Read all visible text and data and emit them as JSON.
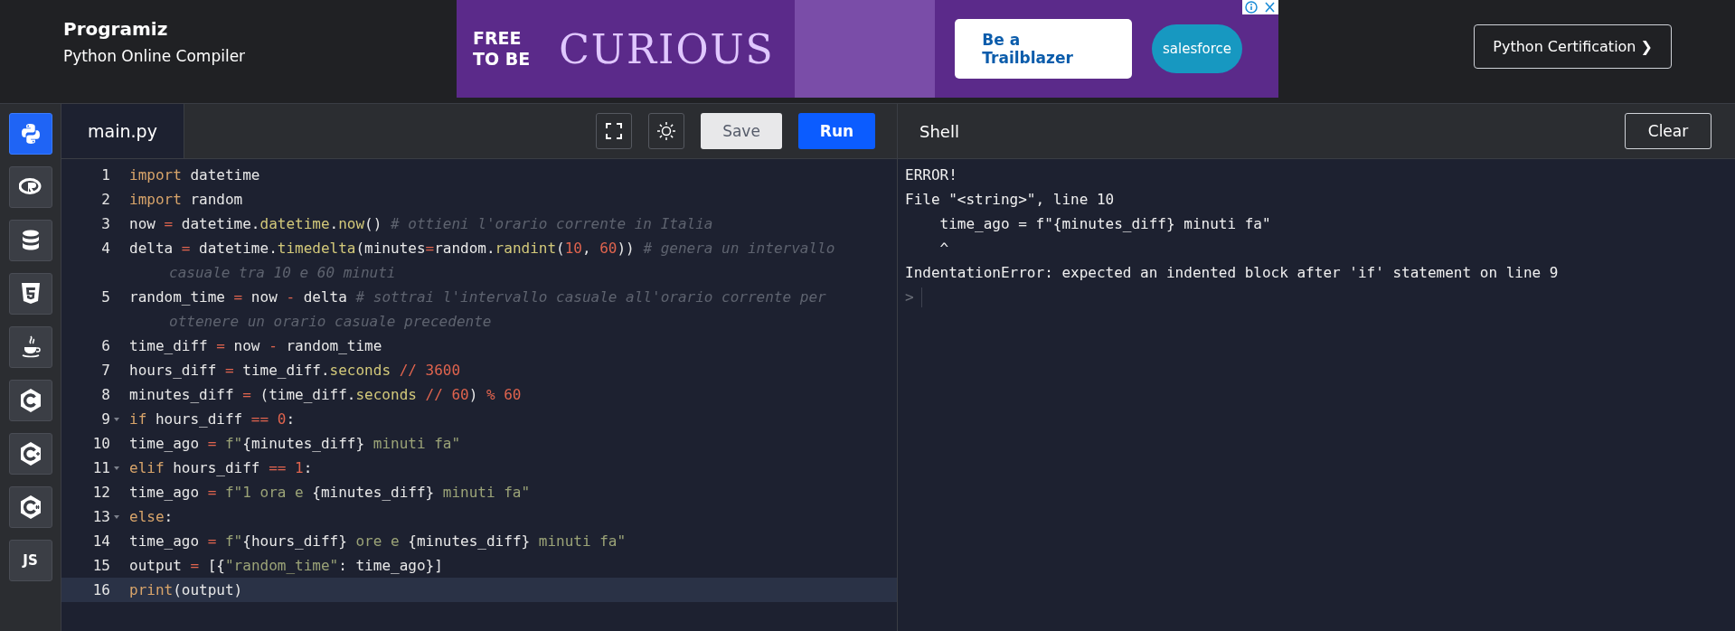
{
  "header": {
    "brand": "Programiz",
    "subtitle": "Python Online Compiler",
    "ad": {
      "headline": "FREE TO BE",
      "wordmark": "CURIOUS",
      "cta": "Be a Trailblazer",
      "sponsor": "salesforce"
    },
    "certification_button": "Python Certification ❯"
  },
  "sidebar": {
    "items": [
      {
        "kind": "python",
        "selected": true
      },
      {
        "kind": "r",
        "selected": false
      },
      {
        "kind": "sql",
        "selected": false
      },
      {
        "kind": "html",
        "selected": false
      },
      {
        "kind": "java",
        "selected": false
      },
      {
        "kind": "c",
        "selected": false
      },
      {
        "kind": "cpp",
        "selected": false
      },
      {
        "kind": "csharp",
        "selected": false
      },
      {
        "kind": "js",
        "label": "JS",
        "selected": false
      }
    ]
  },
  "editor": {
    "tab": "main.py",
    "save_button": "Save",
    "run_button": "Run",
    "lines": [
      {
        "number": "1",
        "fold": false,
        "current": false,
        "tokens": [
          {
            "kind": "kw",
            "text": "import"
          },
          {
            "kind": "p",
            "text": " datetime"
          }
        ]
      },
      {
        "number": "2",
        "fold": false,
        "current": false,
        "tokens": [
          {
            "kind": "kw",
            "text": "import"
          },
          {
            "kind": "p",
            "text": " random"
          }
        ]
      },
      {
        "number": "3",
        "fold": false,
        "current": false,
        "tokens": [
          {
            "kind": "p",
            "text": "now "
          },
          {
            "kind": "op",
            "text": "="
          },
          {
            "kind": "p",
            "text": " datetime."
          },
          {
            "kind": "fn",
            "text": "datetime"
          },
          {
            "kind": "p",
            "text": "."
          },
          {
            "kind": "fn",
            "text": "now"
          },
          {
            "kind": "p",
            "text": "() "
          },
          {
            "kind": "cm",
            "text": "# ottieni l'orario corrente in Italia"
          }
        ]
      },
      {
        "number": "4",
        "fold": false,
        "current": false,
        "tokens": [
          {
            "kind": "p",
            "text": "delta "
          },
          {
            "kind": "op",
            "text": "="
          },
          {
            "kind": "p",
            "text": " datetime."
          },
          {
            "kind": "fn",
            "text": "timedelta"
          },
          {
            "kind": "p",
            "text": "(minutes"
          },
          {
            "kind": "op",
            "text": "="
          },
          {
            "kind": "p",
            "text": "random."
          },
          {
            "kind": "fn",
            "text": "randint"
          },
          {
            "kind": "p",
            "text": "("
          },
          {
            "kind": "num",
            "text": "10"
          },
          {
            "kind": "p",
            "text": ", "
          },
          {
            "kind": "num",
            "text": "60"
          },
          {
            "kind": "p",
            "text": ")) "
          },
          {
            "kind": "cm",
            "text": "# genera un intervallo casuale tra 10 e 60 minuti"
          }
        ]
      },
      {
        "number": "5",
        "fold": false,
        "current": false,
        "tokens": [
          {
            "kind": "p",
            "text": "random_time "
          },
          {
            "kind": "op",
            "text": "="
          },
          {
            "kind": "p",
            "text": " now "
          },
          {
            "kind": "op",
            "text": "-"
          },
          {
            "kind": "p",
            "text": " delta "
          },
          {
            "kind": "cm",
            "text": "# sottrai l'intervallo casuale all'orario corrente per ottenere un orario casuale precedente"
          }
        ]
      },
      {
        "number": "6",
        "fold": false,
        "current": false,
        "tokens": [
          {
            "kind": "p",
            "text": "time_diff "
          },
          {
            "kind": "op",
            "text": "="
          },
          {
            "kind": "p",
            "text": " now "
          },
          {
            "kind": "op",
            "text": "-"
          },
          {
            "kind": "p",
            "text": " random_time"
          }
        ]
      },
      {
        "number": "7",
        "fold": false,
        "current": false,
        "tokens": [
          {
            "kind": "p",
            "text": "hours_diff "
          },
          {
            "kind": "op",
            "text": "="
          },
          {
            "kind": "p",
            "text": " time_diff."
          },
          {
            "kind": "fn",
            "text": "seconds"
          },
          {
            "kind": "op",
            "text": " // "
          },
          {
            "kind": "num",
            "text": "3600"
          }
        ]
      },
      {
        "number": "8",
        "fold": false,
        "current": false,
        "tokens": [
          {
            "kind": "p",
            "text": "minutes_diff "
          },
          {
            "kind": "op",
            "text": "="
          },
          {
            "kind": "p",
            "text": " (time_diff."
          },
          {
            "kind": "fn",
            "text": "seconds"
          },
          {
            "kind": "op",
            "text": " // "
          },
          {
            "kind": "num",
            "text": "60"
          },
          {
            "kind": "p",
            "text": ") "
          },
          {
            "kind": "op",
            "text": "% "
          },
          {
            "kind": "num",
            "text": "60"
          }
        ]
      },
      {
        "number": "9",
        "fold": true,
        "current": false,
        "tokens": [
          {
            "kind": "kw",
            "text": "if"
          },
          {
            "kind": "p",
            "text": " hours_diff "
          },
          {
            "kind": "op",
            "text": "== "
          },
          {
            "kind": "num",
            "text": "0"
          },
          {
            "kind": "p",
            "text": ":"
          }
        ]
      },
      {
        "number": "10",
        "fold": false,
        "current": false,
        "tokens": [
          {
            "kind": "p",
            "text": "time_ago "
          },
          {
            "kind": "op",
            "text": "="
          },
          {
            "kind": "str",
            "text": " f\""
          },
          {
            "kind": "p",
            "text": "{minutes_diff}"
          },
          {
            "kind": "str",
            "text": " minuti fa\""
          }
        ]
      },
      {
        "number": "11",
        "fold": true,
        "current": false,
        "tokens": [
          {
            "kind": "kw",
            "text": "elif"
          },
          {
            "kind": "p",
            "text": " hours_diff "
          },
          {
            "kind": "op",
            "text": "== "
          },
          {
            "kind": "num",
            "text": "1"
          },
          {
            "kind": "p",
            "text": ":"
          }
        ]
      },
      {
        "number": "12",
        "fold": false,
        "current": false,
        "tokens": [
          {
            "kind": "p",
            "text": "time_ago "
          },
          {
            "kind": "op",
            "text": "="
          },
          {
            "kind": "str",
            "text": " f\"1 ora e "
          },
          {
            "kind": "p",
            "text": "{minutes_diff}"
          },
          {
            "kind": "str",
            "text": " minuti fa\""
          }
        ]
      },
      {
        "number": "13",
        "fold": true,
        "current": false,
        "tokens": [
          {
            "kind": "kw",
            "text": "else"
          },
          {
            "kind": "p",
            "text": ":"
          }
        ]
      },
      {
        "number": "14",
        "fold": false,
        "current": false,
        "tokens": [
          {
            "kind": "p",
            "text": "time_ago "
          },
          {
            "kind": "op",
            "text": "="
          },
          {
            "kind": "str",
            "text": " f\""
          },
          {
            "kind": "p",
            "text": "{hours_diff}"
          },
          {
            "kind": "str",
            "text": " ore e "
          },
          {
            "kind": "p",
            "text": "{minutes_diff}"
          },
          {
            "kind": "str",
            "text": " minuti fa\""
          }
        ]
      },
      {
        "number": "15",
        "fold": false,
        "current": false,
        "tokens": [
          {
            "kind": "p",
            "text": "output "
          },
          {
            "kind": "op",
            "text": "="
          },
          {
            "kind": "p",
            "text": " [{"
          },
          {
            "kind": "str",
            "text": "\"random_time\""
          },
          {
            "kind": "p",
            "text": ": time_ago}]"
          }
        ]
      },
      {
        "number": "16",
        "fold": false,
        "current": true,
        "tokens": [
          {
            "kind": "kw",
            "text": "print"
          },
          {
            "kind": "p",
            "text": "(output)"
          }
        ]
      }
    ]
  },
  "shell": {
    "title": "Shell",
    "clear_button": "Clear",
    "output": [
      "ERROR!",
      "File \"<string>\", line 10",
      "    time_ago = f\"{minutes_diff} minuti fa\"",
      "    ^",
      "IndentationError: expected an indented block after 'if' statement on line 9"
    ],
    "prompt": ">"
  }
}
